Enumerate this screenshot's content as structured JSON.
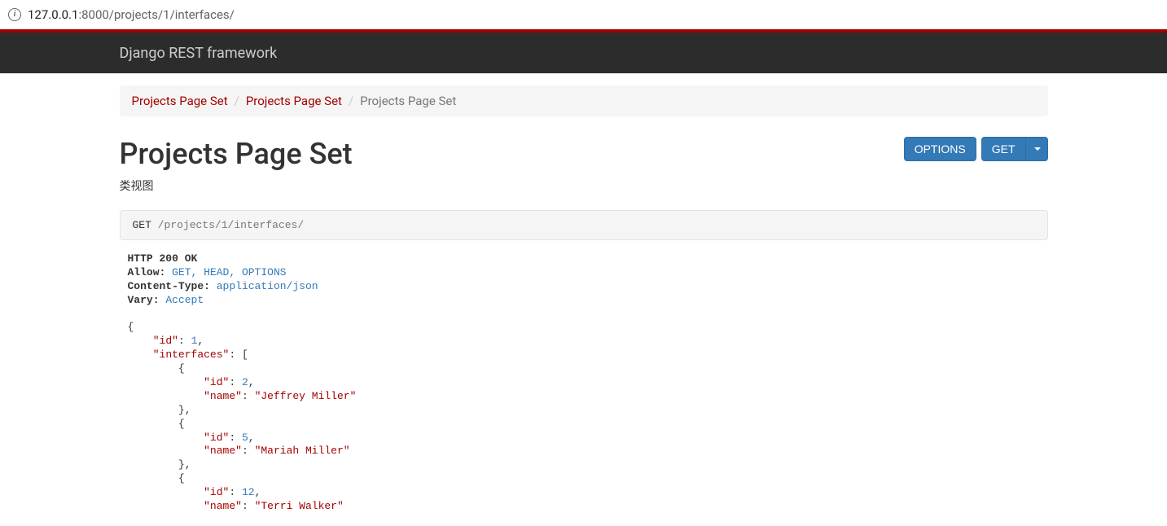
{
  "browser": {
    "url_host": "127.0.0.1",
    "url_port_path": ":8000/projects/1/interfaces/"
  },
  "navbar": {
    "brand": "Django REST framework"
  },
  "breadcrumb": {
    "items": [
      {
        "label": "Projects Page Set",
        "active": false
      },
      {
        "label": "Projects Page Set",
        "active": false
      },
      {
        "label": "Projects Page Set",
        "active": true
      }
    ]
  },
  "page": {
    "title": "Projects Page Set",
    "subtitle": "类视图"
  },
  "buttons": {
    "options": "OPTIONS",
    "get": "GET"
  },
  "request": {
    "method": "GET",
    "path": "/projects/1/interfaces/"
  },
  "response": {
    "status_line": "HTTP 200 OK",
    "headers": [
      {
        "name": "Allow:",
        "value": "GET, HEAD, OPTIONS"
      },
      {
        "name": "Content-Type:",
        "value": "application/json"
      },
      {
        "name": "Vary:",
        "value": "Accept"
      }
    ],
    "body": {
      "id": 1,
      "interfaces": [
        {
          "id": 2,
          "name": "Jeffrey Miller"
        },
        {
          "id": 5,
          "name": "Mariah Miller"
        },
        {
          "id": 12,
          "name": "Terri Walker"
        }
      ]
    }
  }
}
